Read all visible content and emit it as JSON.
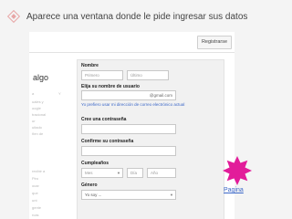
{
  "slide": {
    "bullet_text": "Aparece una ventana donde le pide ingresar sus datos",
    "star_color": "#e21c9a",
    "follow_link": "Pagina"
  },
  "screenshot": {
    "register_button": "Registrarse",
    "left_heading": "algo",
    "left_fragments": [
      "a",
      "Y",
      "uales y",
      "oogle",
      "tracional",
      "ur",
      "uitado",
      "ñen de",
      "recibir a",
      "Piro",
      "ocar",
      "que",
      "unt",
      "gente",
      "rcas"
    ],
    "form": {
      "name_label": "Nombre",
      "first_name_placeholder": "Primero",
      "last_name_placeholder": "Último",
      "username_label": "Elija su nombre de usuario",
      "username_suffix": "@gmail.com",
      "alt_email_link": "Yo prefiero usar mi dirección de correo electrónico actual",
      "password_label": "Cree una contraseña",
      "confirm_label": "Confirme su contraseña",
      "birthday_label": "Cumpleaños",
      "month_placeholder": "Mes",
      "day_placeholder": "Día",
      "year_placeholder": "Año",
      "gender_label": "Género",
      "gender_value": "Yo soy ..."
    }
  }
}
